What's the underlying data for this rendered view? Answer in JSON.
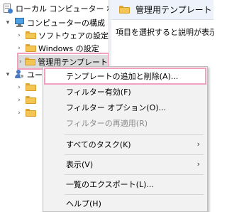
{
  "tree": {
    "root": {
      "label": "ローカル コンピューター ポリシー"
    },
    "computer_config": {
      "label": "コンピューターの構成"
    },
    "software_settings": {
      "label": "ソフトウェアの設定"
    },
    "windows_settings": {
      "label": "Windows の設定"
    },
    "admin_templates": {
      "label": "管理用テンプレート"
    },
    "user_config": {
      "label": "ユーザーの構成"
    }
  },
  "right_pane": {
    "header_title": "管理用テンプレート",
    "description": "項目を選択すると説明が表示されます。"
  },
  "context_menu": {
    "items": [
      {
        "label": "テンプレートの追加と削除(A)...",
        "enabled": true
      },
      {
        "label": "フィルター有効(F)",
        "enabled": true
      },
      {
        "label": "フィルター オプション(O)...",
        "enabled": true
      },
      {
        "label": "フィルターの再適用(R)",
        "enabled": false
      },
      {
        "label": "すべてのタスク(K)",
        "enabled": true,
        "submenu": true
      },
      {
        "label": "表示(V)",
        "enabled": true,
        "submenu": true
      },
      {
        "label": "一覧のエクスポート(L)...",
        "enabled": true
      },
      {
        "label": "ヘルプ(H)",
        "enabled": true
      }
    ],
    "submenu_arrow": "›"
  },
  "colors": {
    "highlight_border": "#f2a0c0",
    "folder": "#f3c553",
    "header_bg": "#eef3fb"
  },
  "icons": [
    "policy-icon",
    "computer-icon",
    "folder-icon",
    "user-icon",
    "chevron-down-icon",
    "chevron-right-icon"
  ]
}
